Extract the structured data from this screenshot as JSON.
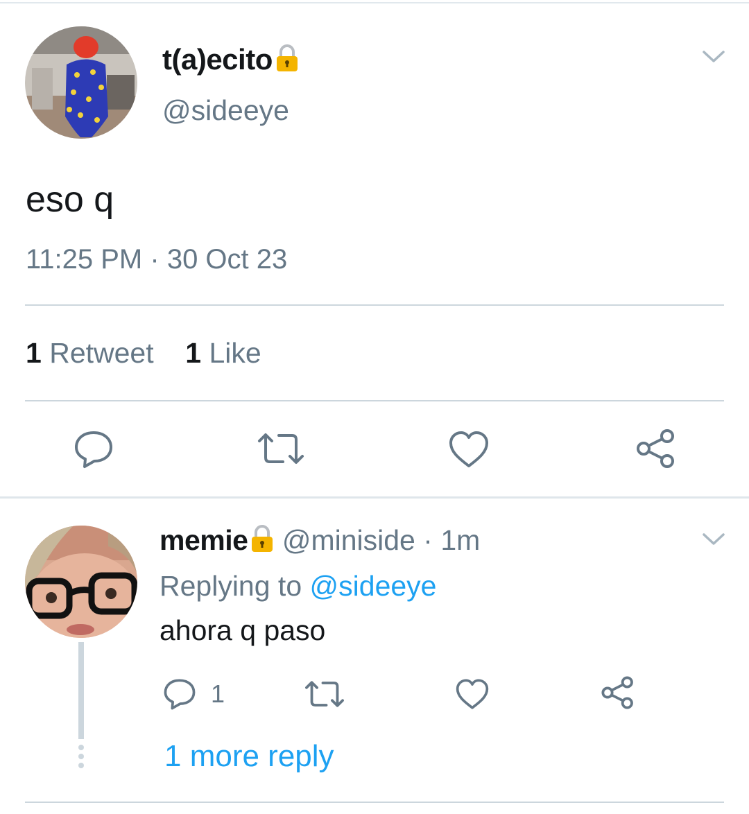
{
  "main_tweet": {
    "display_name": "t(a)ecito",
    "handle": "@sideeye",
    "text": "eso q",
    "time": "11:25 PM",
    "separator": "·",
    "date": "30 Oct 23",
    "retweet_count": "1",
    "retweet_label": "Retweet",
    "like_count": "1",
    "like_label": "Like",
    "lock_icon": "lock-icon"
  },
  "reply": {
    "display_name": "memie",
    "handle": "@miniside",
    "separator": "·",
    "age": "1m",
    "replying_prefix": "Replying to",
    "replying_mention": "@sideeye",
    "text": "ahora q paso",
    "reply_count": "1",
    "more_replies": "1 more reply"
  },
  "colors": {
    "accent": "#1da1f2",
    "secondary_text": "#657786",
    "divider": "#ccd6dd",
    "lock_gold": "#f4b400"
  }
}
